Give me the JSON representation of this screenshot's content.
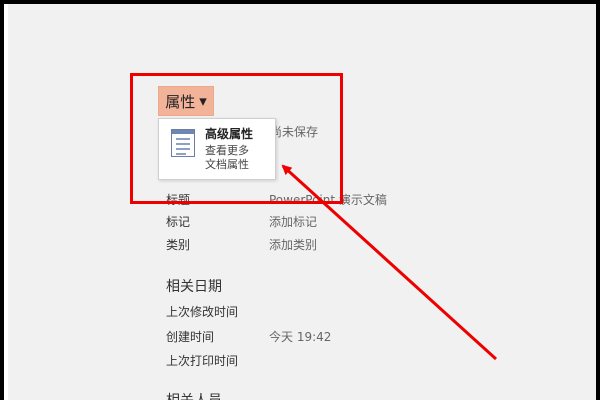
{
  "properties": {
    "button_label": "属性",
    "caret": "▾",
    "menu": {
      "title": "高级属性",
      "description": [
        "查看更多",
        "文档属性"
      ],
      "icon": "document-properties-icon"
    },
    "hidden_value": "尚未保存"
  },
  "fields": [
    {
      "label": "标题",
      "value": "PowerPoint 演示文稿"
    },
    {
      "label": "标记",
      "value": "添加标记"
    },
    {
      "label": "类别",
      "value": "添加类别"
    }
  ],
  "related_dates": {
    "heading": "相关日期",
    "rows": [
      {
        "label": "上次修改时间",
        "value": ""
      },
      {
        "label": "创建时间",
        "value": "今天 19:42"
      },
      {
        "label": "上次打印时间",
        "value": ""
      }
    ]
  },
  "related_people": {
    "heading": "相关人员"
  },
  "annotation": {
    "highlight_color": "#e00000"
  }
}
